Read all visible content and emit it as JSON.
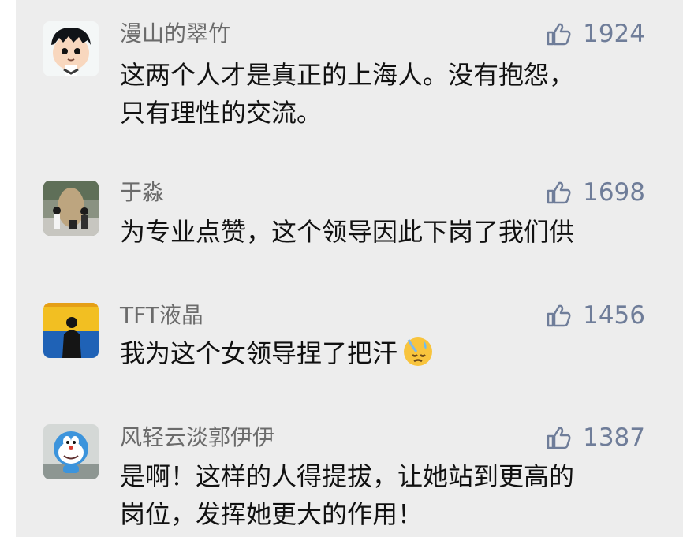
{
  "comments": [
    {
      "username": "漫山的翠竹",
      "likes": "1924",
      "lines": [
        "这两个人才是真正的上海人。没有抱怨，",
        "只有理性的交流。"
      ],
      "avatar": "cartoon-boy-avatar"
    },
    {
      "username": "于淼",
      "likes": "1698",
      "lines": [
        "为专业点赞，这个领导因此下岗了我们供"
      ],
      "avatar": "photo-people-stone-avatar"
    },
    {
      "username": "TFT液晶",
      "likes": "1456",
      "lines": [
        "我为这个女领导捏了把汗"
      ],
      "avatar": "silhouette-yellow-blue-avatar",
      "emoji": "sweat-face-emoji"
    },
    {
      "username": "风轻云淡郭伊伊",
      "likes": "1387",
      "lines": [
        "是啊！这样的人得提拔，让她站到更高的",
        "岗位，发挥她更大的作用！"
      ],
      "avatar": "doraemon-figure-avatar"
    }
  ],
  "colors": {
    "panel_background": "#ededed",
    "username": "#6b6b6b",
    "like": "#6f7d99",
    "text": "#111111"
  },
  "icons": {
    "like": "thumbs-up-icon"
  }
}
